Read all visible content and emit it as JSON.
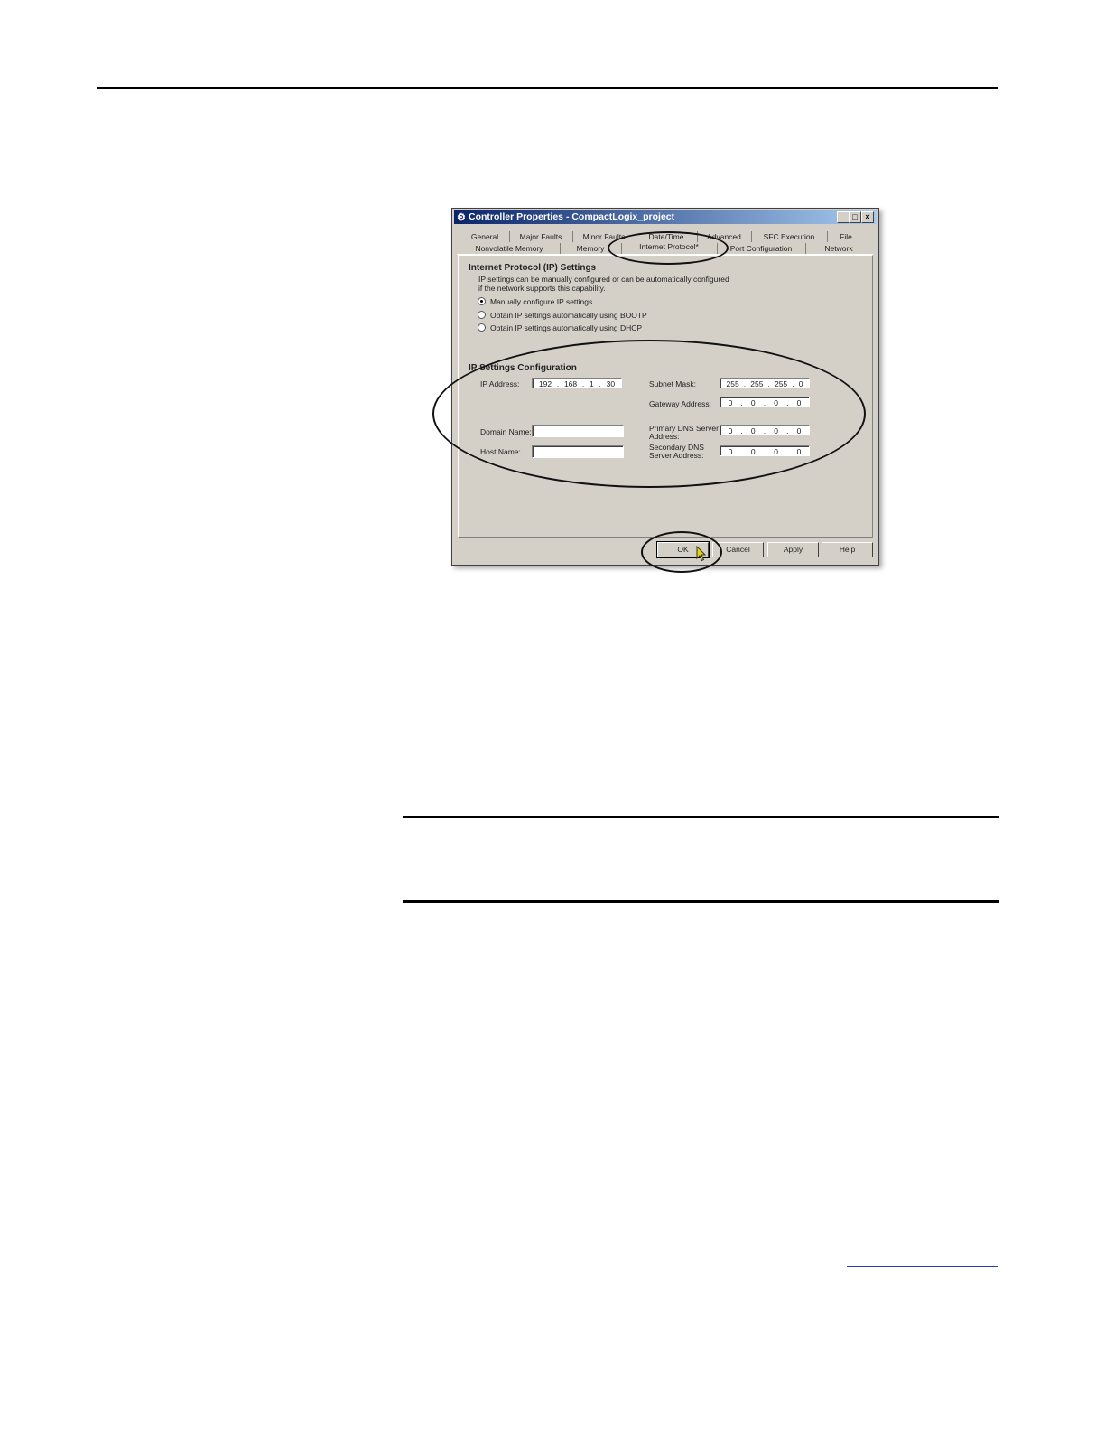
{
  "dialog": {
    "title": "Controller Properties - CompactLogix_project",
    "controls": {
      "minimize": "_",
      "maximize": "□",
      "close": "×"
    },
    "tabs_row1": [
      "General",
      "Major Faults",
      "Minor Faults",
      "Date/Time",
      "Advanced",
      "SFC Execution",
      "File"
    ],
    "tabs_row2": [
      "Nonvolatile Memory",
      "Memory",
      "Internet Protocol*",
      "Port Configuration",
      "Network"
    ],
    "active_tab": "Internet Protocol*",
    "section_title": "Internet Protocol (IP) Settings",
    "description": [
      "IP settings can be manually configured or can be automatically configured",
      "if the network supports this capability."
    ],
    "radio_options": [
      {
        "label": "Manually configure IP settings",
        "selected": true
      },
      {
        "label": "Obtain IP settings automatically using BOOTP",
        "selected": false
      },
      {
        "label": "Obtain IP settings automatically using DHCP",
        "selected": false
      }
    ],
    "config_title": "IP Settings Configuration",
    "ip_address": {
      "label": "IP Address:",
      "octets": [
        "192",
        "168",
        "1",
        "30"
      ]
    },
    "subnet_mask": {
      "label": "Subnet Mask:",
      "octets": [
        "255",
        "255",
        "255",
        "0"
      ]
    },
    "gateway": {
      "label": "Gateway Address:",
      "octets": [
        "0",
        "0",
        "0",
        "0"
      ]
    },
    "domain_name": {
      "label": "Domain Name:",
      "value": ""
    },
    "host_name": {
      "label": "Host Name:",
      "value": ""
    },
    "primary_dns": {
      "label_line1": "Primary DNS Server",
      "label_line2": "Address:",
      "octets": [
        "0",
        "0",
        "0",
        "0"
      ]
    },
    "secondary_dns": {
      "label_line1": "Secondary DNS",
      "label_line2": "Server Address:",
      "octets": [
        "0",
        "0",
        "0",
        "0"
      ]
    },
    "buttons": {
      "ok": "OK",
      "cancel": "Cancel",
      "apply": "Apply",
      "help": "Help"
    },
    "icons": {
      "app": "controller-icon",
      "cursor": "pointer-cursor-icon"
    },
    "colors": {
      "titlebar_start": "#0a246a",
      "titlebar_end": "#a6caf0",
      "window": "#d4d0c8",
      "cursor": "#e6d200"
    }
  }
}
